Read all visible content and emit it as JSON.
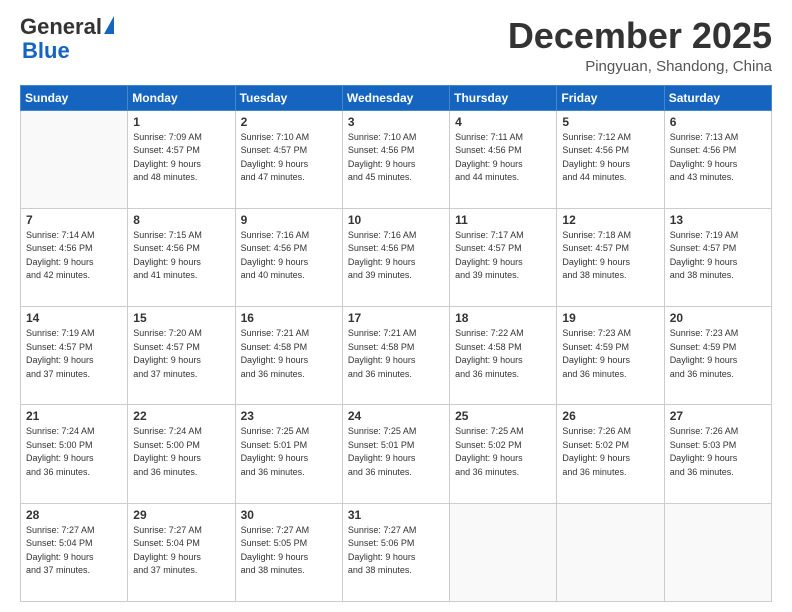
{
  "header": {
    "logo_general": "General",
    "logo_blue": "Blue",
    "month_title": "December 2025",
    "location": "Pingyuan, Shandong, China"
  },
  "days_of_week": [
    "Sunday",
    "Monday",
    "Tuesday",
    "Wednesday",
    "Thursday",
    "Friday",
    "Saturday"
  ],
  "weeks": [
    [
      {
        "day": "",
        "info": ""
      },
      {
        "day": "1",
        "info": "Sunrise: 7:09 AM\nSunset: 4:57 PM\nDaylight: 9 hours\nand 48 minutes."
      },
      {
        "day": "2",
        "info": "Sunrise: 7:10 AM\nSunset: 4:57 PM\nDaylight: 9 hours\nand 47 minutes."
      },
      {
        "day": "3",
        "info": "Sunrise: 7:10 AM\nSunset: 4:56 PM\nDaylight: 9 hours\nand 45 minutes."
      },
      {
        "day": "4",
        "info": "Sunrise: 7:11 AM\nSunset: 4:56 PM\nDaylight: 9 hours\nand 44 minutes."
      },
      {
        "day": "5",
        "info": "Sunrise: 7:12 AM\nSunset: 4:56 PM\nDaylight: 9 hours\nand 44 minutes."
      },
      {
        "day": "6",
        "info": "Sunrise: 7:13 AM\nSunset: 4:56 PM\nDaylight: 9 hours\nand 43 minutes."
      }
    ],
    [
      {
        "day": "7",
        "info": "Sunrise: 7:14 AM\nSunset: 4:56 PM\nDaylight: 9 hours\nand 42 minutes."
      },
      {
        "day": "8",
        "info": "Sunrise: 7:15 AM\nSunset: 4:56 PM\nDaylight: 9 hours\nand 41 minutes."
      },
      {
        "day": "9",
        "info": "Sunrise: 7:16 AM\nSunset: 4:56 PM\nDaylight: 9 hours\nand 40 minutes."
      },
      {
        "day": "10",
        "info": "Sunrise: 7:16 AM\nSunset: 4:56 PM\nDaylight: 9 hours\nand 39 minutes."
      },
      {
        "day": "11",
        "info": "Sunrise: 7:17 AM\nSunset: 4:57 PM\nDaylight: 9 hours\nand 39 minutes."
      },
      {
        "day": "12",
        "info": "Sunrise: 7:18 AM\nSunset: 4:57 PM\nDaylight: 9 hours\nand 38 minutes."
      },
      {
        "day": "13",
        "info": "Sunrise: 7:19 AM\nSunset: 4:57 PM\nDaylight: 9 hours\nand 38 minutes."
      }
    ],
    [
      {
        "day": "14",
        "info": "Sunrise: 7:19 AM\nSunset: 4:57 PM\nDaylight: 9 hours\nand 37 minutes."
      },
      {
        "day": "15",
        "info": "Sunrise: 7:20 AM\nSunset: 4:57 PM\nDaylight: 9 hours\nand 37 minutes."
      },
      {
        "day": "16",
        "info": "Sunrise: 7:21 AM\nSunset: 4:58 PM\nDaylight: 9 hours\nand 36 minutes."
      },
      {
        "day": "17",
        "info": "Sunrise: 7:21 AM\nSunset: 4:58 PM\nDaylight: 9 hours\nand 36 minutes."
      },
      {
        "day": "18",
        "info": "Sunrise: 7:22 AM\nSunset: 4:58 PM\nDaylight: 9 hours\nand 36 minutes."
      },
      {
        "day": "19",
        "info": "Sunrise: 7:23 AM\nSunset: 4:59 PM\nDaylight: 9 hours\nand 36 minutes."
      },
      {
        "day": "20",
        "info": "Sunrise: 7:23 AM\nSunset: 4:59 PM\nDaylight: 9 hours\nand 36 minutes."
      }
    ],
    [
      {
        "day": "21",
        "info": "Sunrise: 7:24 AM\nSunset: 5:00 PM\nDaylight: 9 hours\nand 36 minutes."
      },
      {
        "day": "22",
        "info": "Sunrise: 7:24 AM\nSunset: 5:00 PM\nDaylight: 9 hours\nand 36 minutes."
      },
      {
        "day": "23",
        "info": "Sunrise: 7:25 AM\nSunset: 5:01 PM\nDaylight: 9 hours\nand 36 minutes."
      },
      {
        "day": "24",
        "info": "Sunrise: 7:25 AM\nSunset: 5:01 PM\nDaylight: 9 hours\nand 36 minutes."
      },
      {
        "day": "25",
        "info": "Sunrise: 7:25 AM\nSunset: 5:02 PM\nDaylight: 9 hours\nand 36 minutes."
      },
      {
        "day": "26",
        "info": "Sunrise: 7:26 AM\nSunset: 5:02 PM\nDaylight: 9 hours\nand 36 minutes."
      },
      {
        "day": "27",
        "info": "Sunrise: 7:26 AM\nSunset: 5:03 PM\nDaylight: 9 hours\nand 36 minutes."
      }
    ],
    [
      {
        "day": "28",
        "info": "Sunrise: 7:27 AM\nSunset: 5:04 PM\nDaylight: 9 hours\nand 37 minutes."
      },
      {
        "day": "29",
        "info": "Sunrise: 7:27 AM\nSunset: 5:04 PM\nDaylight: 9 hours\nand 37 minutes."
      },
      {
        "day": "30",
        "info": "Sunrise: 7:27 AM\nSunset: 5:05 PM\nDaylight: 9 hours\nand 38 minutes."
      },
      {
        "day": "31",
        "info": "Sunrise: 7:27 AM\nSunset: 5:06 PM\nDaylight: 9 hours\nand 38 minutes."
      },
      {
        "day": "",
        "info": ""
      },
      {
        "day": "",
        "info": ""
      },
      {
        "day": "",
        "info": ""
      }
    ]
  ]
}
